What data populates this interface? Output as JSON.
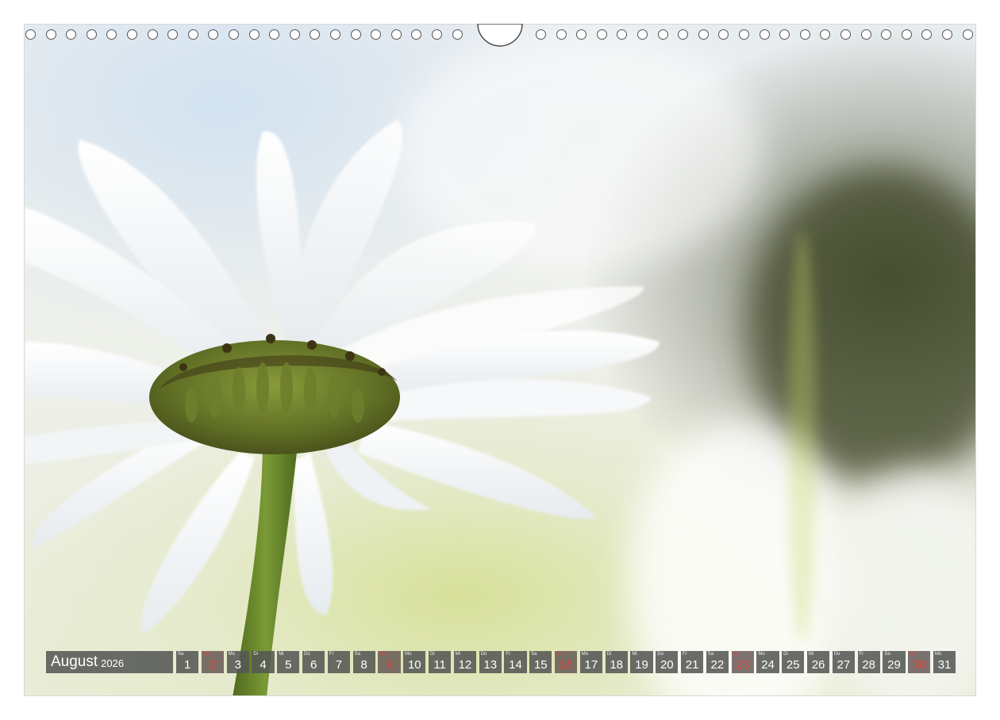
{
  "calendar": {
    "month": "August",
    "year": "2026",
    "days": [
      {
        "dow": "Sa",
        "num": "1",
        "holiday": false
      },
      {
        "dow": "So",
        "num": "2",
        "holiday": true
      },
      {
        "dow": "Mo",
        "num": "3",
        "holiday": false
      },
      {
        "dow": "Di",
        "num": "4",
        "holiday": false
      },
      {
        "dow": "Mi",
        "num": "5",
        "holiday": false
      },
      {
        "dow": "Do",
        "num": "6",
        "holiday": false
      },
      {
        "dow": "Fr",
        "num": "7",
        "holiday": false
      },
      {
        "dow": "Sa",
        "num": "8",
        "holiday": false
      },
      {
        "dow": "So",
        "num": "9",
        "holiday": true
      },
      {
        "dow": "Mo",
        "num": "10",
        "holiday": false
      },
      {
        "dow": "Di",
        "num": "11",
        "holiday": false
      },
      {
        "dow": "Mi",
        "num": "12",
        "holiday": false
      },
      {
        "dow": "Do",
        "num": "13",
        "holiday": false
      },
      {
        "dow": "Fr",
        "num": "14",
        "holiday": false
      },
      {
        "dow": "Sa",
        "num": "15",
        "holiday": false
      },
      {
        "dow": "So",
        "num": "16",
        "holiday": true
      },
      {
        "dow": "Mo",
        "num": "17",
        "holiday": false
      },
      {
        "dow": "Di",
        "num": "18",
        "holiday": false
      },
      {
        "dow": "Mi",
        "num": "19",
        "holiday": false
      },
      {
        "dow": "Do",
        "num": "20",
        "holiday": false
      },
      {
        "dow": "Fr",
        "num": "21",
        "holiday": false
      },
      {
        "dow": "Sa",
        "num": "22",
        "holiday": false
      },
      {
        "dow": "So",
        "num": "23",
        "holiday": true
      },
      {
        "dow": "Mo",
        "num": "24",
        "holiday": false
      },
      {
        "dow": "Di",
        "num": "25",
        "holiday": false
      },
      {
        "dow": "Mi",
        "num": "26",
        "holiday": false
      },
      {
        "dow": "Do",
        "num": "27",
        "holiday": false
      },
      {
        "dow": "Fr",
        "num": "28",
        "holiday": false
      },
      {
        "dow": "Sa",
        "num": "29",
        "holiday": false
      },
      {
        "dow": "So",
        "num": "30",
        "holiday": true
      },
      {
        "dow": "Mo",
        "num": "31",
        "holiday": false
      }
    ]
  },
  "colors": {
    "cell_background": "#555854",
    "cell_text": "#ffffff",
    "holiday_text": "#e2403a"
  },
  "binding": {
    "hole_count_left": 22,
    "hole_count_right": 22,
    "hanger": "ring-hanger-icon"
  },
  "photo": {
    "subject": "daisy-flower-photo"
  }
}
